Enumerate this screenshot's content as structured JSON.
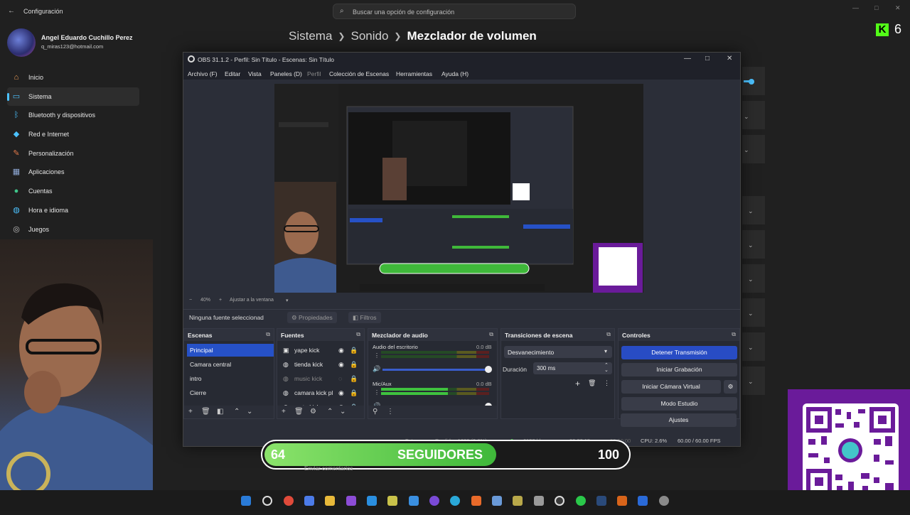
{
  "settings": {
    "title": "Configuración",
    "search_placeholder": "Buscar una opción de configuración",
    "profile": {
      "name": "Angel Eduardo Cuchillo Perez",
      "email": "q_miras123@hotmail.com"
    },
    "nav": [
      {
        "label": "Inicio",
        "icon": "home-icon",
        "color": "#f4a259"
      },
      {
        "label": "Sistema",
        "icon": "display-icon",
        "color": "#4cc2ff",
        "selected": true
      },
      {
        "label": "Bluetooth y dispositivos",
        "icon": "bluetooth-icon",
        "color": "#4cc2ff"
      },
      {
        "label": "Red e Internet",
        "icon": "wifi-icon",
        "color": "#4cc2ff"
      },
      {
        "label": "Personalización",
        "icon": "brush-icon",
        "color": "#e57a4a"
      },
      {
        "label": "Aplicaciones",
        "icon": "apps-icon",
        "color": "#8fa9d6"
      },
      {
        "label": "Cuentas",
        "icon": "person-icon",
        "color": "#3fc58a"
      },
      {
        "label": "Hora e idioma",
        "icon": "globe-icon",
        "color": "#4cc2ff"
      },
      {
        "label": "Juegos",
        "icon": "gamepad-icon",
        "color": "#bfbfbf"
      }
    ],
    "breadcrumb": [
      "Sistema",
      "Sonido",
      "Mezclador de volumen"
    ]
  },
  "overlay": {
    "kick_count": "6",
    "followers": {
      "current": "64",
      "label": "SEGUIDORES",
      "goal": "100",
      "fraction": 0.64
    }
  },
  "obs": {
    "title": "OBS 31.1.2 - Perfil: Sin Título - Escenas: Sin Título",
    "menu": [
      "Archivo (F)",
      "Editar",
      "Vista",
      "Paneles (D)",
      "Perfil",
      "Colección de Escenas",
      "Herramientas",
      "Ayuda (H)"
    ],
    "zoom": "40%",
    "fit_label": "Ajustar a la ventana",
    "no_source": "Ninguna fuente seleccionad",
    "properties_label": "Propiedades",
    "filters_label": "Filtros",
    "scenes": {
      "header": "Escenas",
      "items": [
        "Principal",
        "Camara central",
        "intro",
        "Cierre"
      ]
    },
    "sources": {
      "header": "Fuentes",
      "items": [
        {
          "label": "yape kick",
          "icon": "image-icon"
        },
        {
          "label": "tienda kick",
          "icon": "globe-icon"
        },
        {
          "label": "music kick",
          "icon": "globe-icon",
          "hidden": true
        },
        {
          "label": "camara kick pl",
          "icon": "globe-icon"
        },
        {
          "label": "meta kick",
          "icon": "globe-icon"
        }
      ]
    },
    "mixer": {
      "header": "Mezclador de audio",
      "channels": [
        {
          "name": "Audio del escritorio",
          "db": "0.0 dB",
          "level": 0.0
        },
        {
          "name": "Mic/Aux",
          "db": "0.0 dB",
          "level": 0.62
        }
      ]
    },
    "transitions": {
      "header": "Transiciones de escena",
      "selected": "Desvanecimiento",
      "duration_label": "Duración",
      "duration_value": "300 ms"
    },
    "controls": {
      "header": "Controles",
      "buttons": [
        "Detener Transmisión",
        "Iniciar Grabación",
        "Iniciar Cámara Virtual",
        "Modo Estudio",
        "Ajustes"
      ]
    },
    "status": {
      "dropped": "Fotogramas Perdidos 1230 (0.6%)",
      "bitrate": "6152 kbps",
      "live_time": "03:23:15",
      "rec_time": "00:00:00",
      "cpu": "CPU: 2.6%",
      "fps": "60.00 / 60.00 FPS"
    }
  },
  "below_text": "Enviar comentarios",
  "colors": {
    "accent": "#4cc2ff",
    "obs_active": "#284cc4",
    "kick": "#53fc18",
    "qr_frame": "#6a1b9a"
  }
}
